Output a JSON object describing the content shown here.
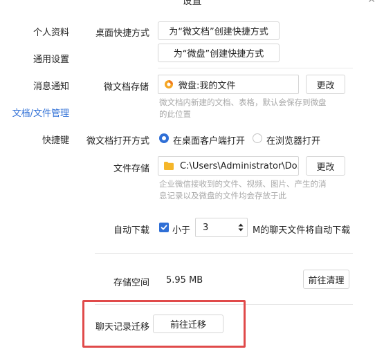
{
  "window": {
    "title": "设置"
  },
  "sidebar": {
    "items": [
      {
        "label": "个人资料"
      },
      {
        "label": "通用设置"
      },
      {
        "label": "消息通知"
      },
      {
        "label": "文档/文件管理"
      },
      {
        "label": "快捷键"
      }
    ],
    "active_index": 3
  },
  "desktop_shortcut": {
    "label": "桌面快捷方式",
    "btn_doc": "为“微文档”创建快捷方式",
    "btn_disk": "为“微盘”创建快捷方式"
  },
  "doc_storage": {
    "label": "微文档存储",
    "value": "微盘:我的文件",
    "change_btn": "更改",
    "hint_line1": "微文档内新建的文档、表格，默认会保存到微盘",
    "hint_line2": "的此位置"
  },
  "doc_open": {
    "label": "微文档打开方式",
    "option_desktop": "在桌面客户端打开",
    "option_browser": "在浏览器打开",
    "selected": "在桌面客户端打开"
  },
  "file_storage": {
    "label": "文件存储",
    "value": "C:\\Users\\Administrator\\Do...",
    "change_btn": "更改",
    "hint_line1": "企业微信接收到的文件、视频、图片、产生的消",
    "hint_line2": "息记录以及微盘的文件均会存放于此"
  },
  "auto_download": {
    "label": "自动下载",
    "checked": true,
    "less_than": "小于",
    "size_value": "3",
    "suffix": "M的聊天文件将自动下载"
  },
  "storage_space": {
    "label": "存储空间",
    "value": "5.95 MB",
    "clean_btn": "前往清理"
  },
  "chat_migration": {
    "label": "聊天记录迁移",
    "migrate_btn": "前往迁移"
  },
  "colors": {
    "accent": "#2f6fd6",
    "highlight": "#e04a4a"
  }
}
